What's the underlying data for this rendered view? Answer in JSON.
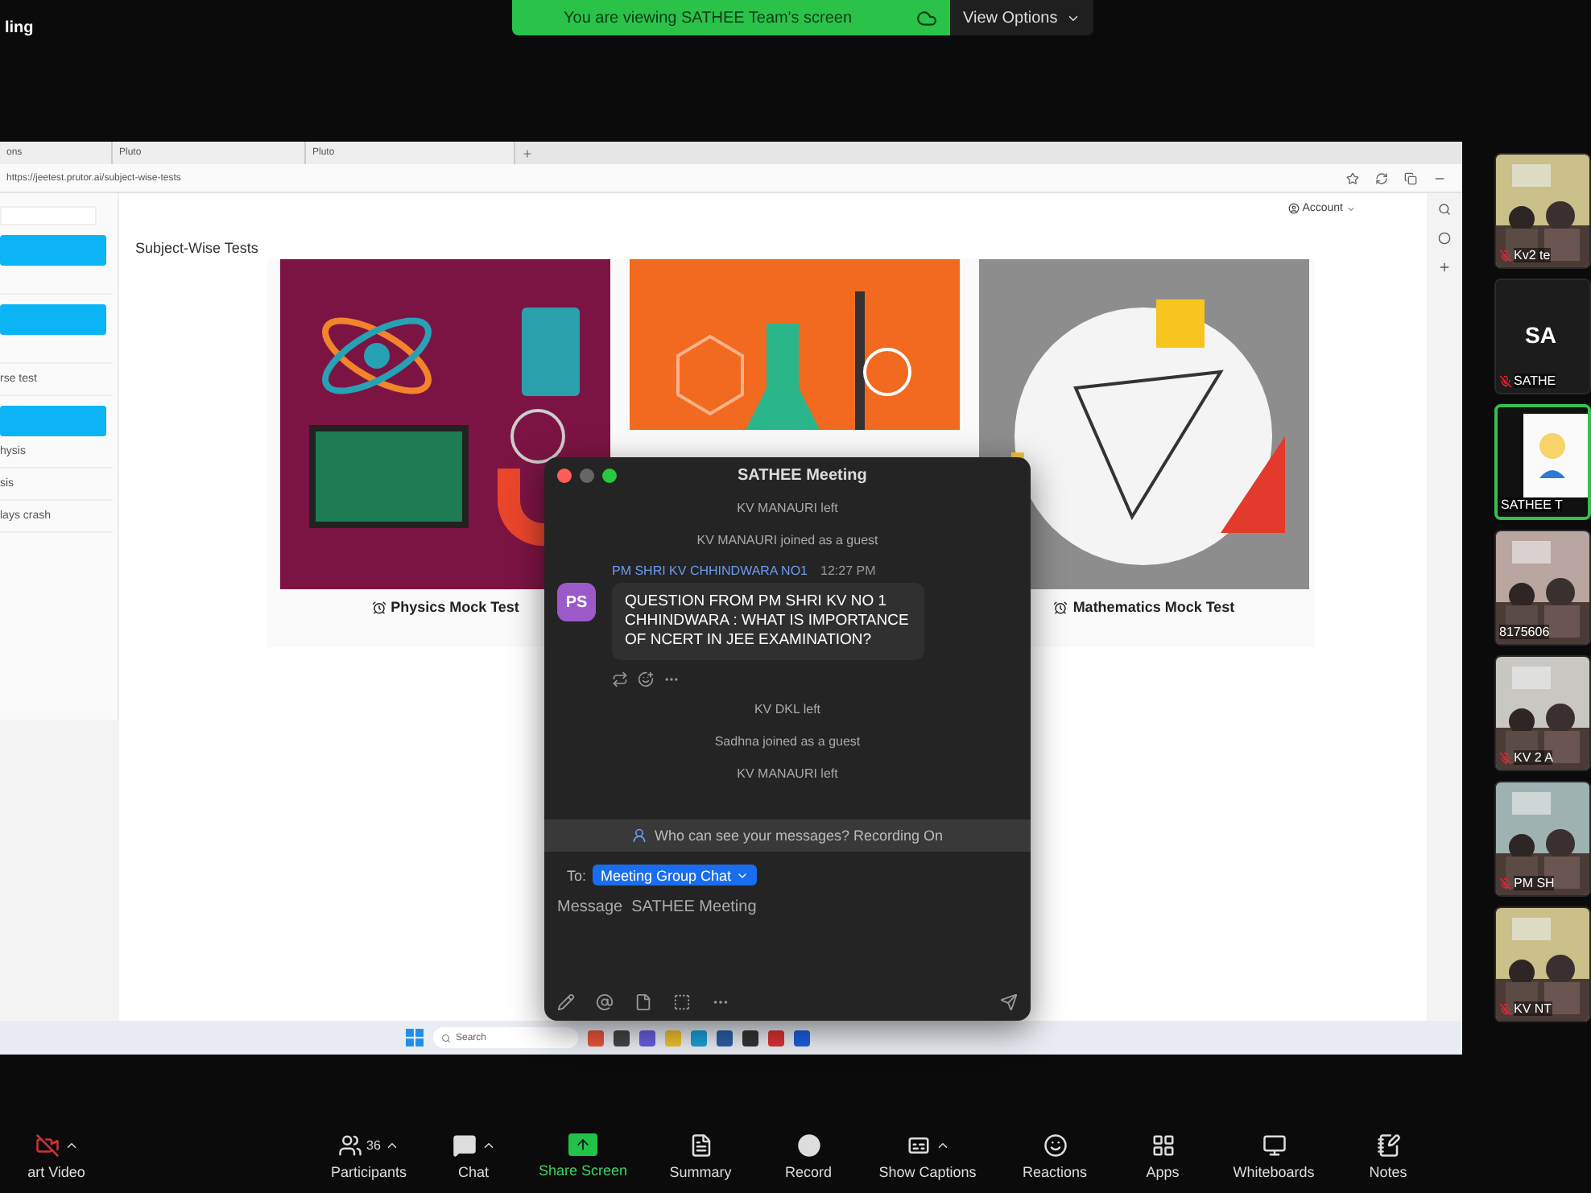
{
  "title_fragment": "ling",
  "banner": {
    "text": "You are viewing SATHEE Team's screen",
    "view_options": "View Options"
  },
  "browser": {
    "tabs": [
      {
        "label": "ons"
      },
      {
        "label": "Pluto"
      },
      {
        "label": "Pluto"
      }
    ],
    "url": "https://jeetest.prutor.ai/subject-wise-tests",
    "account": "Account",
    "sidebar_items": [
      {
        "kind": "field"
      },
      {
        "kind": "button"
      },
      {
        "kind": "line"
      },
      {
        "kind": "button"
      },
      {
        "kind": "line"
      },
      {
        "kind": "text",
        "label": "rse test"
      },
      {
        "kind": "button"
      },
      {
        "kind": "text",
        "label": "hysis"
      },
      {
        "kind": "text",
        "label": "sis"
      },
      {
        "kind": "text",
        "label": "lays crash"
      }
    ],
    "heading": "Subject-Wise Tests",
    "cards": [
      {
        "kind": "physics",
        "caption": "Physics Mock Test"
      },
      {
        "kind": "chemistry"
      },
      {
        "kind": "math",
        "caption": "Mathematics Mock Test"
      }
    ],
    "taskbar_search": "Search"
  },
  "chat": {
    "title": "SATHEE Meeting",
    "messages": [
      {
        "kind": "system",
        "text": "KV MANAURI left"
      },
      {
        "kind": "system",
        "text": "KV MANAURI joined as a guest"
      },
      {
        "kind": "message",
        "avatar": "PS",
        "sender": "PM SHRI KV CHHINDWARA NO1",
        "time": "12:27 PM",
        "text": "QUESTION FROM PM SHRI KV NO 1 CHHINDWARA : WHAT IS IMPORTANCE OF NCERT IN JEE EXAMINATION?"
      },
      {
        "kind": "system",
        "text": "KV DKL left"
      },
      {
        "kind": "system",
        "text": "Sadhna joined as a guest"
      },
      {
        "kind": "system",
        "text": "KV MANAURI left"
      }
    ],
    "notice": "Who can see your messages? Recording On",
    "to_label": "To:",
    "recipient": "Meeting Group Chat",
    "placeholder": "Message  SATHEE Meeting"
  },
  "participants": [
    {
      "kind": "video",
      "name": "Kv2 te",
      "muted": true,
      "speaking": false
    },
    {
      "kind": "avatar",
      "initials": "SA",
      "name": "SATHE",
      "muted": true,
      "speaking": false
    },
    {
      "kind": "screen",
      "name": "SATHEE T",
      "muted": false,
      "speaking": true
    },
    {
      "kind": "video",
      "name": "8175606",
      "muted": false,
      "speaking": false
    },
    {
      "kind": "video",
      "name": "KV 2 A",
      "muted": true,
      "speaking": false
    },
    {
      "kind": "video",
      "name": "PM SH",
      "muted": true,
      "speaking": false
    },
    {
      "kind": "video",
      "name": "KV NT",
      "muted": true,
      "speaking": false
    }
  ],
  "toolbar": [
    {
      "kind": "video",
      "label": "art Video",
      "caret": true
    },
    {
      "kind": "participants",
      "label": "Participants",
      "count": "36",
      "caret": true
    },
    {
      "kind": "chat",
      "label": "Chat",
      "caret": true
    },
    {
      "kind": "share",
      "label": "Share Screen",
      "caret": false
    },
    {
      "kind": "summary",
      "label": "Summary",
      "caret": false
    },
    {
      "kind": "record",
      "label": "Record",
      "caret": false
    },
    {
      "kind": "captions",
      "label": "Show Captions",
      "caret": true
    },
    {
      "kind": "reactions",
      "label": "Reactions",
      "caret": false
    },
    {
      "kind": "apps",
      "label": "Apps",
      "caret": false
    },
    {
      "kind": "whiteboards",
      "label": "Whiteboards",
      "caret": false
    },
    {
      "kind": "notes",
      "label": "Notes",
      "caret": false
    }
  ]
}
